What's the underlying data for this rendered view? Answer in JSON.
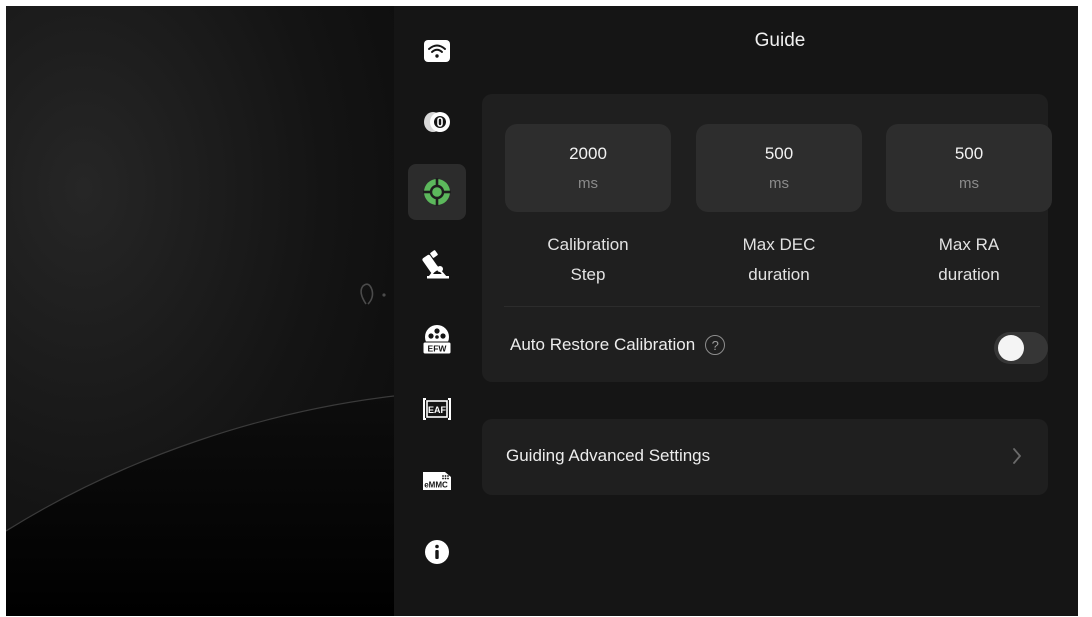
{
  "page_title": "Guide",
  "sidebar": {
    "items": [
      {
        "icon": "wifi-icon",
        "active": false
      },
      {
        "icon": "camera-icon",
        "active": false
      },
      {
        "icon": "guide-target-icon",
        "active": true
      },
      {
        "icon": "telescope-mount-icon",
        "active": false
      },
      {
        "icon": "filter-wheel-icon",
        "active": false
      },
      {
        "icon": "focuser-icon",
        "active": false
      },
      {
        "icon": "storage-icon",
        "active": false
      },
      {
        "icon": "info-icon",
        "active": false
      }
    ]
  },
  "calibration": {
    "params": [
      {
        "value": "2000",
        "unit": "ms",
        "label": "Calibration\nStep"
      },
      {
        "value": "500",
        "unit": "ms",
        "label": "Max DEC\nduration"
      },
      {
        "value": "500",
        "unit": "ms",
        "label": "Max RA\nduration"
      }
    ],
    "auto_restore_label": "Auto Restore Calibration",
    "help_glyph": "?",
    "auto_restore_enabled": false
  },
  "advanced": {
    "label": "Guiding Advanced Settings"
  },
  "icon_labels": {
    "efw": "EFW",
    "eaf": "EAF",
    "emmc": "eMMC"
  },
  "colors": {
    "accent": "#5cb85c",
    "panel": "#151515",
    "card": "#1f1f1f"
  }
}
